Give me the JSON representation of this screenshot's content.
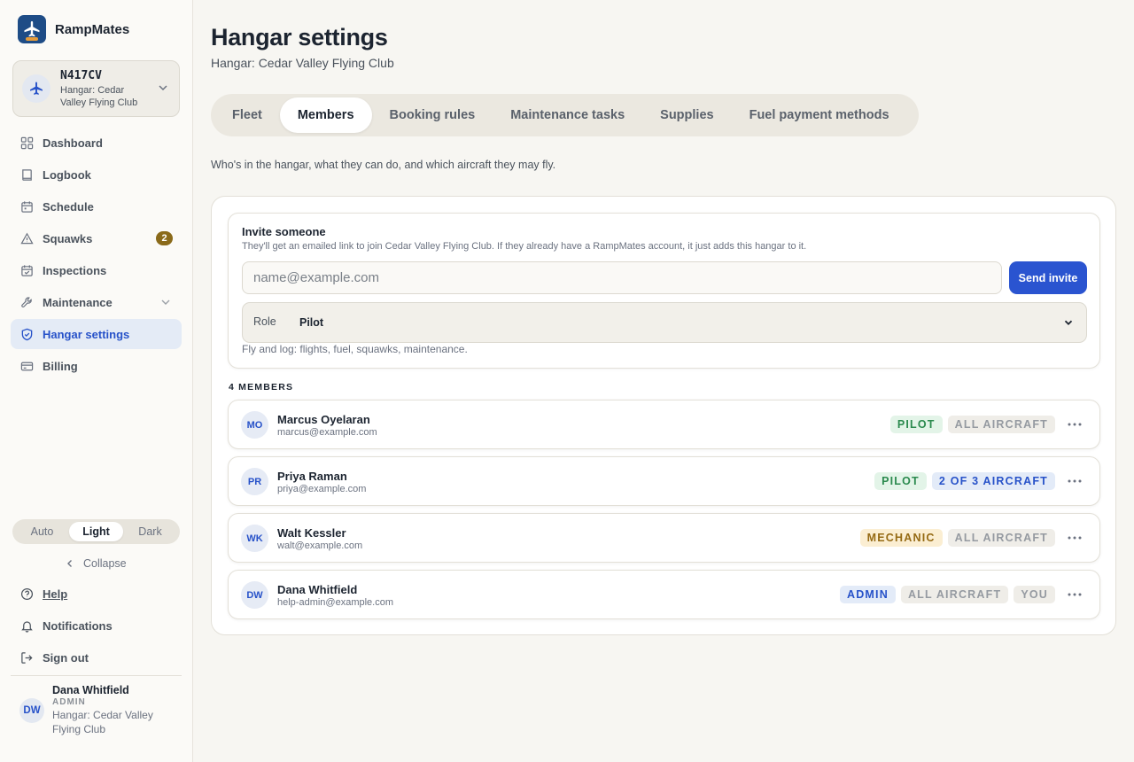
{
  "app": {
    "name": "RampMates"
  },
  "aircraft": {
    "tail": "N417CV",
    "hangar": "Hangar: Cedar Valley Flying Club"
  },
  "nav": {
    "items": [
      {
        "label": "Dashboard",
        "icon": "dashboard-icon"
      },
      {
        "label": "Logbook",
        "icon": "logbook-icon"
      },
      {
        "label": "Schedule",
        "icon": "calendar-icon"
      },
      {
        "label": "Squawks",
        "icon": "warning-icon",
        "badge": "2"
      },
      {
        "label": "Inspections",
        "icon": "calendar-check-icon"
      },
      {
        "label": "Maintenance",
        "icon": "wrench-icon"
      },
      {
        "label": "Hangar settings",
        "icon": "shield-icon",
        "active": true
      },
      {
        "label": "Billing",
        "icon": "credit-card-icon"
      }
    ]
  },
  "theme": {
    "options": [
      "Auto",
      "Light",
      "Dark"
    ],
    "selected": "Light"
  },
  "collapse_label": "Collapse",
  "utility": {
    "help": "Help",
    "notifications": "Notifications",
    "sign_out": "Sign out"
  },
  "user": {
    "initials": "DW",
    "name": "Dana Whitfield",
    "role": "ADMIN",
    "hangar": "Hangar: Cedar Valley Flying Club"
  },
  "page": {
    "title": "Hangar settings",
    "subtitle": "Hangar: Cedar Valley Flying Club",
    "tabs": [
      "Fleet",
      "Members",
      "Booking rules",
      "Maintenance tasks",
      "Supplies",
      "Fuel payment methods"
    ],
    "active_tab": "Members",
    "lead": "Who's in the hangar, what they can do, and which aircraft they may fly."
  },
  "invite": {
    "title": "Invite someone",
    "description": "They'll get an emailed link to join Cedar Valley Flying Club. If they already have a RampMates account, it just adds this hangar to it.",
    "email_placeholder": "name@example.com",
    "send_label": "Send invite",
    "role_label": "Role",
    "role_value": "Pilot",
    "role_help": "Fly and log: flights, fuel, squawks, maintenance."
  },
  "members": {
    "count_label": "4 MEMBERS",
    "rows": [
      {
        "initials": "MO",
        "name": "Marcus Oyelaran",
        "email": "marcus@example.com",
        "role": "PILOT",
        "access": "ALL AIRCRAFT"
      },
      {
        "initials": "PR",
        "name": "Priya Raman",
        "email": "priya@example.com",
        "role": "PILOT",
        "access": "2 OF 3 AIRCRAFT"
      },
      {
        "initials": "WK",
        "name": "Walt Kessler",
        "email": "walt@example.com",
        "role": "MECHANIC",
        "access": "ALL AIRCRAFT"
      },
      {
        "initials": "DW",
        "name": "Dana Whitfield",
        "email": "help-admin@example.com",
        "role": "ADMIN",
        "access": "ALL AIRCRAFT",
        "you": "YOU"
      }
    ]
  },
  "colors": {
    "accent": "#2a54d0",
    "sidebar_active_bg": "#e4ebf6",
    "badge": "#8a6a1a",
    "pilot": "#2b8a4e",
    "mechanic": "#956a14"
  }
}
